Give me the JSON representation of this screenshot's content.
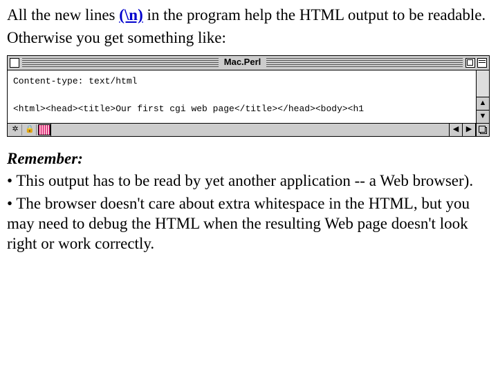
{
  "intro": {
    "part1": "All the new lines ",
    "bold": "(\\n)",
    "part2": " in the program help the HTML output to be readable.",
    "line2": "Otherwise you get something like:"
  },
  "window": {
    "title": "Mac.Perl",
    "content_line1": "Content-type: text/html",
    "content_line2": "<html><head><title>Our first cgi web page</title></head><body><h1"
  },
  "remember": {
    "heading": "Remember:",
    "bullet1": "• This output has to be read by yet another application -- a Web browser).",
    "bullet2": "• The browser doesn't care about extra whitespace in the HTML, but you may need to debug the HTML when the resulting Web page doesn't look right or work correctly."
  }
}
